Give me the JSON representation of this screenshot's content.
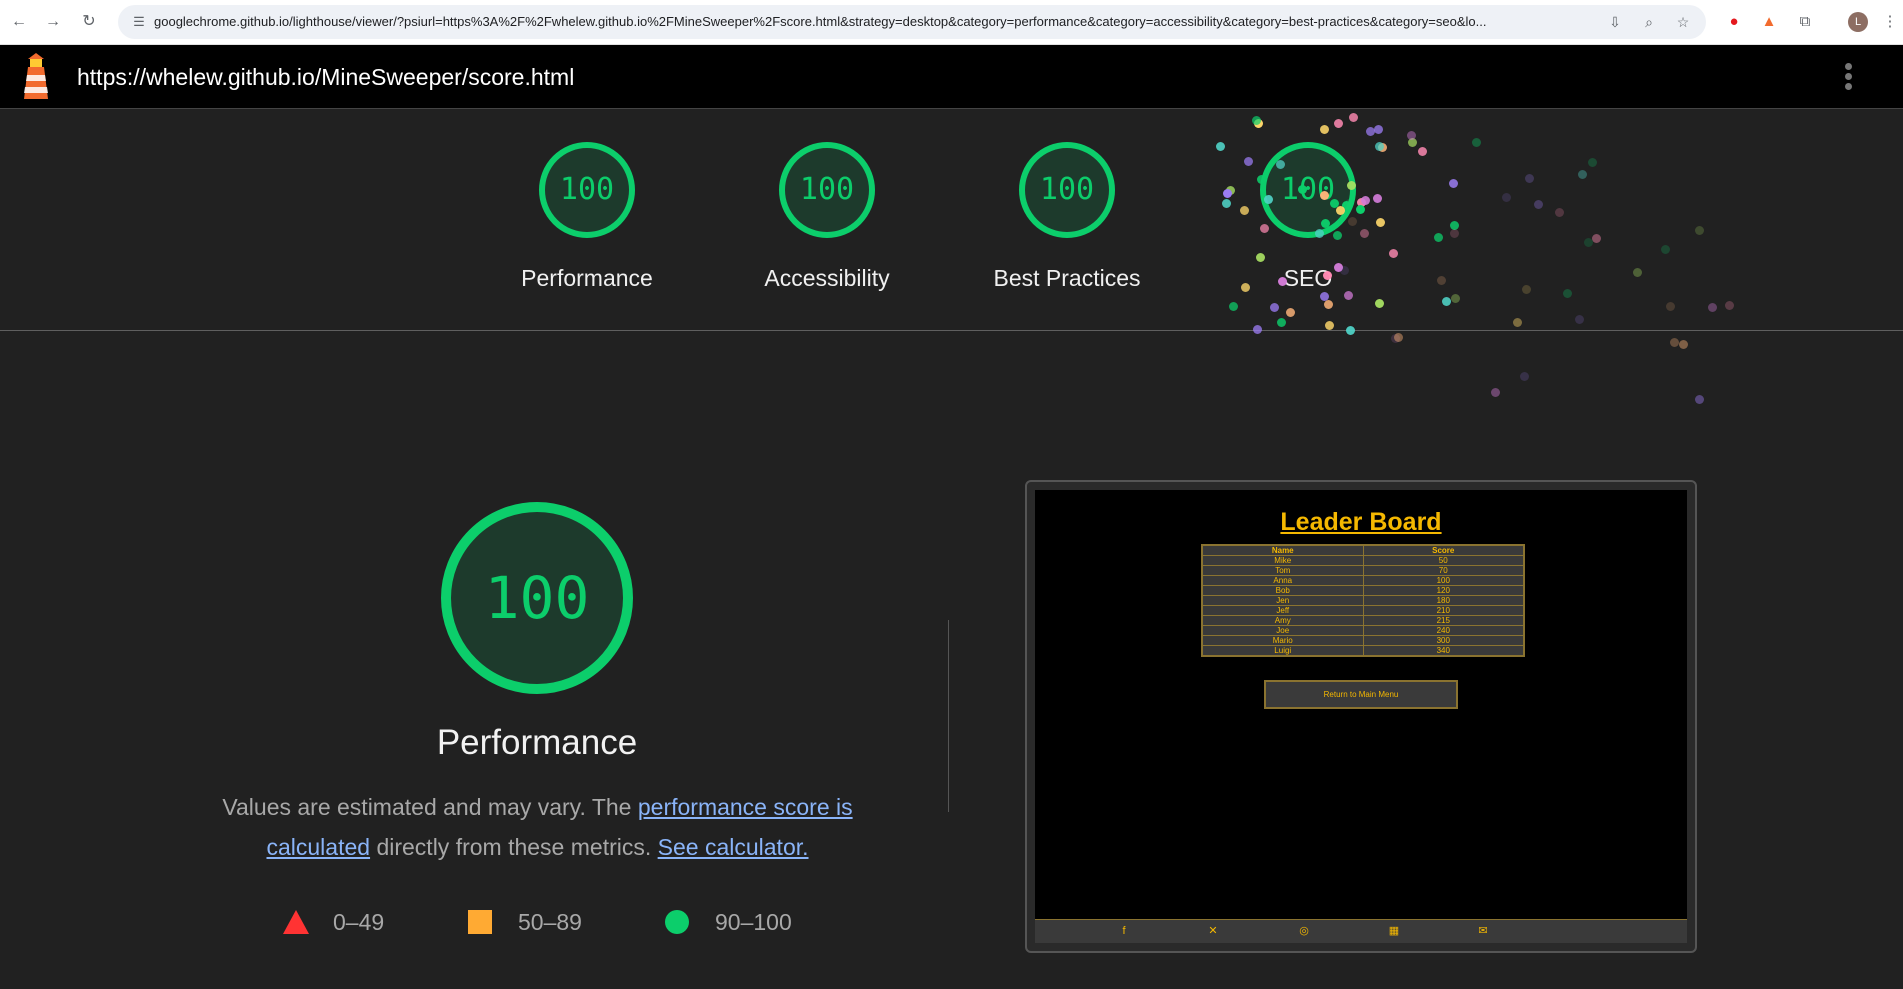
{
  "browser": {
    "url": "googlechrome.github.io/lighthouse/viewer/?psiurl=https%3A%2F%2Fwhelew.github.io%2FMineSweeper%2Fscore.html&strategy=desktop&category=performance&category=accessibility&category=best-practices&category=seo&lo...",
    "avatar_initial": "L",
    "icons": {
      "back": "arrow-left-icon",
      "forward": "arrow-right-icon",
      "reload": "reload-icon",
      "site_info": "tune-icon",
      "install": "install-icon",
      "zoom": "zoom-icon",
      "bookmark": "star-icon",
      "opera": "opera-icon",
      "lighthouse_ext": "lighthouse-extension-icon",
      "extensions": "puzzle-icon",
      "menu": "kebab-menu-icon"
    }
  },
  "lighthouse": {
    "report_url": "https://whelew.github.io/MineSweeper/score.html",
    "gauges": [
      {
        "score": "100",
        "label": "Performance"
      },
      {
        "score": "100",
        "label": "Accessibility"
      },
      {
        "score": "100",
        "label": "Best Practices"
      },
      {
        "score": "100",
        "label": "SEO"
      }
    ],
    "performance": {
      "score": "100",
      "title": "Performance",
      "desc_prefix": "Values are estimated and may vary. The ",
      "desc_link1": "performance score is calculated",
      "desc_middle": " directly from these metrics. ",
      "desc_link2": "See calculator."
    },
    "legend": [
      {
        "range": "0–49",
        "color": "#ff3333",
        "shape": "triangle"
      },
      {
        "range": "50–89",
        "color": "#ffaa33",
        "shape": "square"
      },
      {
        "range": "90–100",
        "color": "#0cce6b",
        "shape": "circle"
      }
    ],
    "colors": {
      "pass": "#0cce6b",
      "background": "#212121"
    }
  },
  "screenshot": {
    "title": "Leader Board",
    "headers": [
      "Name",
      "Score"
    ],
    "rows": [
      [
        "Mike",
        "50"
      ],
      [
        "Tom",
        "70"
      ],
      [
        "Anna",
        "100"
      ],
      [
        "Bob",
        "120"
      ],
      [
        "Jen",
        "180"
      ],
      [
        "Jeff",
        "210"
      ],
      [
        "Amy",
        "215"
      ],
      [
        "Joe",
        "240"
      ],
      [
        "Mario",
        "300"
      ],
      [
        "Luigi",
        "340"
      ]
    ],
    "return_button": "Return to Main Menu",
    "footer_icons": [
      "facebook-icon",
      "x-icon",
      "discord-icon",
      "calendar-icon",
      "mail-icon"
    ]
  }
}
